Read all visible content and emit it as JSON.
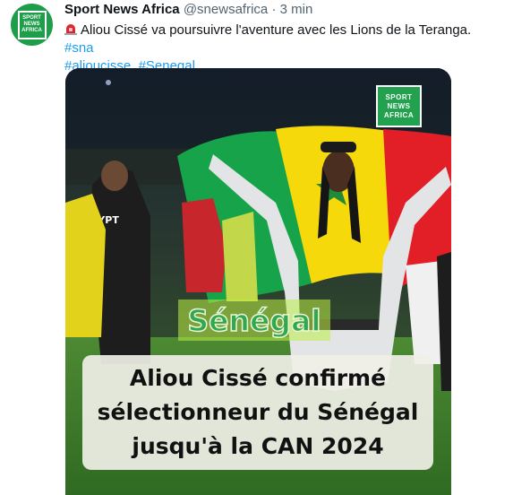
{
  "account": {
    "display_name": "Sport News Africa",
    "handle": "@snewsafrica",
    "separator": "·",
    "time": "3 min",
    "avatar_logo_lines": [
      "SPORT",
      "NEWS",
      "AFRICA"
    ]
  },
  "tweet": {
    "alarm_icon": "rotating-light-icon",
    "text": "Aliou Cissé va poursuivre l'aventure avec les Lions de la Teranga.",
    "hashtags": [
      "#sna",
      "#alioucisse",
      "#Senegal"
    ]
  },
  "media": {
    "watermark_lines": [
      "SPORT",
      "NEWS",
      "AFRICA"
    ],
    "country_label": "Sénégal",
    "caption_lines": [
      "Aliou Cissé confirmé",
      "sélectionneur du Sénégal",
      "jusqu'à la CAN 2024"
    ],
    "jersey_text": "EGYPT"
  },
  "colors": {
    "brand_green": "#22a24f",
    "link_blue": "#1d9bf0",
    "flag_green": "#16a34a",
    "flag_yellow": "#f5d90a",
    "flag_red": "#e21f26"
  }
}
